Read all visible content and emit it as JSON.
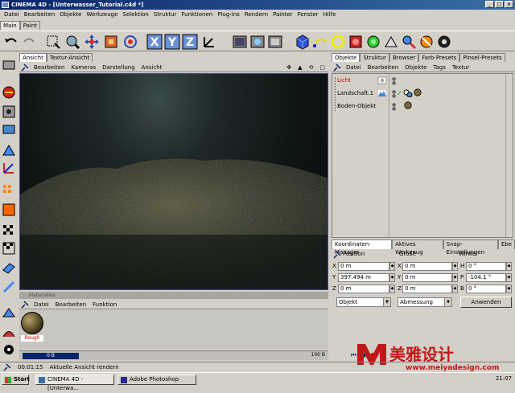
{
  "window": {
    "title": "CINEMA 4D - [Unterwasser_Tutorial.c4d *]"
  },
  "menubar": [
    "Datei",
    "Bearbeiten",
    "Objekte",
    "Werkzeuge",
    "Selektion",
    "Struktur",
    "Funktionen",
    "Plug-ins",
    "Rendern",
    "Painter",
    "Fenster",
    "Hilfe"
  ],
  "toptabs": [
    "Main",
    "Paint"
  ],
  "viewport": {
    "tabs": [
      "Ansicht",
      "Textur-Ansicht"
    ],
    "menu": [
      "Bearbeiten",
      "Kameras",
      "Darstellung",
      "Ansicht"
    ]
  },
  "material": {
    "title": "Materialien",
    "menu": [
      "Datei",
      "Bearbeiten",
      "Funktion"
    ],
    "item_label": "Rough"
  },
  "objects": {
    "tabs": [
      "Objekte",
      "Struktur",
      "Browser",
      "Farb-Presets",
      "Pinsel-Presets"
    ],
    "menu": [
      "Datei",
      "Bearbeiten",
      "Objekte",
      "Tags",
      "Textur"
    ],
    "rows": [
      "Licht",
      "Landschaft.1",
      "Boden-Objekt"
    ],
    "light_color": "#cc0000"
  },
  "coords": {
    "tabs": [
      "Koordinaten-Manager",
      "Aktives Werkzeug",
      "Snap-Einstellungen",
      "Ebe"
    ],
    "headers": [
      "Position",
      "Größe",
      "Winkel"
    ],
    "rows": [
      {
        "a1": "X",
        "v1": "0 m",
        "a2": "X",
        "v2": "0 m",
        "a3": "H",
        "v3": "0 °"
      },
      {
        "a1": "Y",
        "v1": "397.494 m",
        "a2": "Y",
        "v2": "0 m",
        "a3": "P",
        "v3": "-104.1 °"
      },
      {
        "a1": "Z",
        "v1": "0 m",
        "a2": "Z",
        "v2": "0 m",
        "a3": "B",
        "v3": "0 °"
      }
    ],
    "mode1": "Objekt",
    "mode2": "Abmessung",
    "apply": "Anwenden"
  },
  "timeline": {
    "current": "0 B",
    "end": "100 B"
  },
  "status": {
    "time": "00:01:15",
    "text": "Aktuelle Ansicht rendern"
  },
  "taskbar": {
    "start": "Start",
    "tasks": [
      "CINEMA 4D - [Unterwa...",
      "Adobe Photoshop"
    ],
    "clock": "21:07"
  },
  "watermark": {
    "brand": "美雅设计",
    "url": "www.meiyadesign.com"
  }
}
